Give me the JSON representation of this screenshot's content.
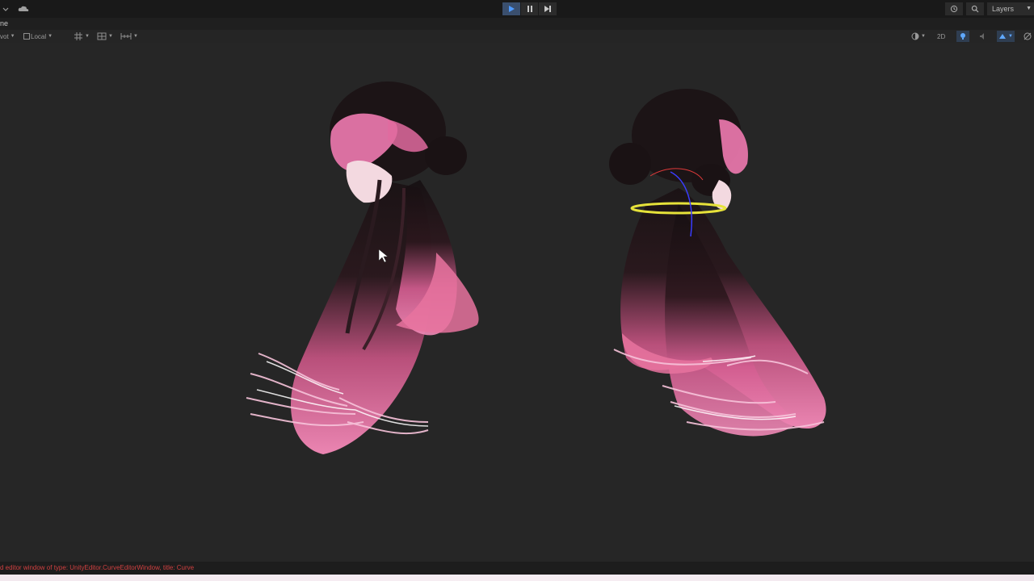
{
  "toolbar": {
    "play_icon": "play-icon",
    "pause_icon": "pause-icon",
    "step_icon": "step-icon",
    "history_icon": "history-icon",
    "search_icon": "search-icon",
    "layers_label": "Layers",
    "cloud_icon": "cloud-icon",
    "play_active_color": "#3a4f6e"
  },
  "scene_tab": {
    "label": "ne"
  },
  "scene_toolbar": {
    "pivot_label": "vot",
    "space_label": "Local",
    "toggle_2d_label": "2D"
  },
  "status": {
    "message": "d editor window of type: UnityEditor.CurveEditorWindow, title: Curve",
    "color": "#d04040"
  },
  "viewport": {
    "background": "#262626",
    "hair_pink": "#f07ab0",
    "hair_dark": "#1a1214"
  }
}
